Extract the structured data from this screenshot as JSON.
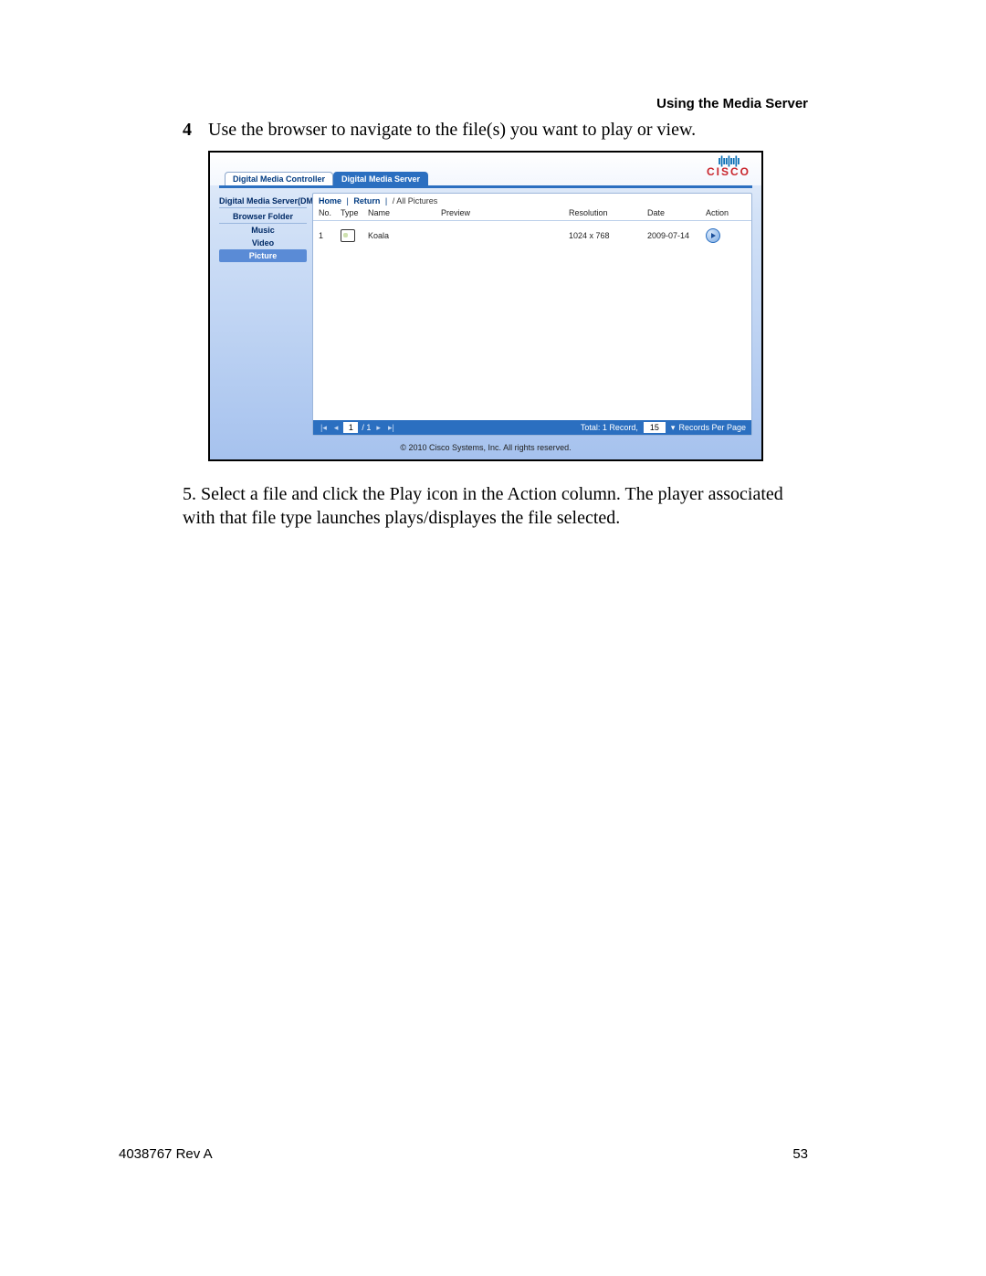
{
  "doc": {
    "header_right": "Using the Media Server",
    "step4_num": "4",
    "step4_text": "Use the browser to navigate to the file(s) you want to play or view.",
    "step5_text": "5. Select a file and click the Play icon in the Action column. The player associated with that file type launches plays/displayes the file selected.",
    "footer_left": "4038767 Rev A",
    "footer_right": "53"
  },
  "ui": {
    "logo": {
      "bars_glyph": "ı|ıı|ıı|ı",
      "brand": "CISCO"
    },
    "tabs": {
      "controller": "Digital Media Controller",
      "server": "Digital Media Server"
    },
    "sidebar": {
      "title": "Digital Media Server(DMS)",
      "subtitle": "Browser Folder",
      "items": [
        "Music",
        "Video",
        "Picture"
      ],
      "selected": "Picture"
    },
    "breadcrumb": {
      "home": "Home",
      "return": "Return",
      "path": "/ All Pictures"
    },
    "columns": {
      "no": "No.",
      "type": "Type",
      "name": "Name",
      "preview": "Preview",
      "resolution": "Resolution",
      "date": "Date",
      "action": "Action"
    },
    "rows": [
      {
        "no": "1",
        "name": "Koala",
        "resolution": "1024 x 768",
        "date": "2009-07-14"
      }
    ],
    "pager": {
      "first": "|◂",
      "prev": "◂",
      "current": "1",
      "total": "/ 1",
      "next": "▸",
      "last": "▸|",
      "total_label": "Total: 1 Record,",
      "rpp_value": "15",
      "rpp_label": "Records Per Page"
    },
    "copyright": "© 2010 Cisco Systems, Inc. All rights reserved."
  }
}
